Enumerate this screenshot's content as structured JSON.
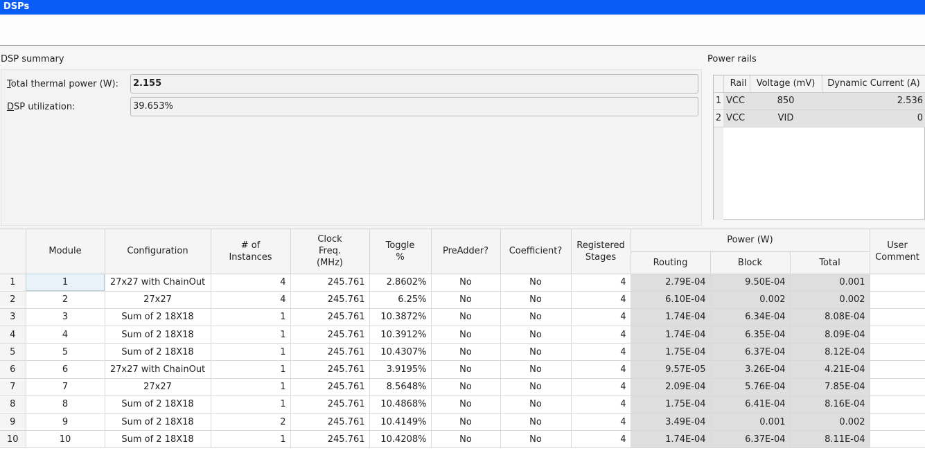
{
  "window": {
    "title": "DSPs"
  },
  "summary": {
    "label": "DSP summary",
    "thermal_label_accel": "T",
    "thermal_label_rest": "otal thermal power (W):",
    "thermal_value": "2.155",
    "util_label_accel": "D",
    "util_label_rest": "SP utilization:",
    "util_value": "39.653%"
  },
  "power_rails": {
    "label": "Power rails",
    "columns": [
      "Rail",
      "Voltage (mV)",
      "Dynamic Current (A)"
    ],
    "rows": [
      [
        "1",
        "VCC",
        "850",
        "2.536"
      ],
      [
        "2",
        "VCC",
        "VID",
        "0"
      ]
    ]
  },
  "table": {
    "headers": {
      "module": "Module",
      "configuration": "Configuration",
      "instances": "# of Instances",
      "clock": "Clock Freq. (MHz)",
      "toggle": "Toggle %",
      "preadder": "PreAdder?",
      "coefficient": "Coefficient?",
      "registered": "Registered Stages",
      "power": "Power (W)",
      "routing": "Routing",
      "block": "Block",
      "total": "Total",
      "comment": "User Comment"
    },
    "rows": [
      [
        "1",
        "1",
        "27x27 with ChainOut",
        "4",
        "245.761",
        "2.8602%",
        "No",
        "No",
        "4",
        "2.79E-04",
        "9.50E-04",
        "0.001",
        ""
      ],
      [
        "2",
        "2",
        "27x27",
        "4",
        "245.761",
        "6.25%",
        "No",
        "No",
        "4",
        "6.10E-04",
        "0.002",
        "0.002",
        ""
      ],
      [
        "3",
        "3",
        "Sum of 2 18X18",
        "1",
        "245.761",
        "10.3872%",
        "No",
        "No",
        "4",
        "1.74E-04",
        "6.34E-04",
        "8.08E-04",
        ""
      ],
      [
        "4",
        "4",
        "Sum of 2 18X18",
        "1",
        "245.761",
        "10.3912%",
        "No",
        "No",
        "4",
        "1.74E-04",
        "6.35E-04",
        "8.09E-04",
        ""
      ],
      [
        "5",
        "5",
        "Sum of 2 18X18",
        "1",
        "245.761",
        "10.4307%",
        "No",
        "No",
        "4",
        "1.75E-04",
        "6.37E-04",
        "8.12E-04",
        ""
      ],
      [
        "6",
        "6",
        "27x27 with ChainOut",
        "1",
        "245.761",
        "3.9195%",
        "No",
        "No",
        "4",
        "9.57E-05",
        "3.26E-04",
        "4.21E-04",
        ""
      ],
      [
        "7",
        "7",
        "27x27",
        "1",
        "245.761",
        "8.5648%",
        "No",
        "No",
        "4",
        "2.09E-04",
        "5.76E-04",
        "7.85E-04",
        ""
      ],
      [
        "8",
        "8",
        "Sum of 2 18X18",
        "1",
        "245.761",
        "10.4868%",
        "No",
        "No",
        "4",
        "1.75E-04",
        "6.41E-04",
        "8.16E-04",
        ""
      ],
      [
        "9",
        "9",
        "Sum of 2 18X18",
        "2",
        "245.761",
        "10.4149%",
        "No",
        "No",
        "4",
        "3.49E-04",
        "0.001",
        "0.002",
        ""
      ],
      [
        "10",
        "10",
        "Sum of 2 18X18",
        "1",
        "245.761",
        "10.4208%",
        "No",
        "No",
        "4",
        "1.74E-04",
        "6.37E-04",
        "8.11E-04",
        ""
      ]
    ]
  }
}
